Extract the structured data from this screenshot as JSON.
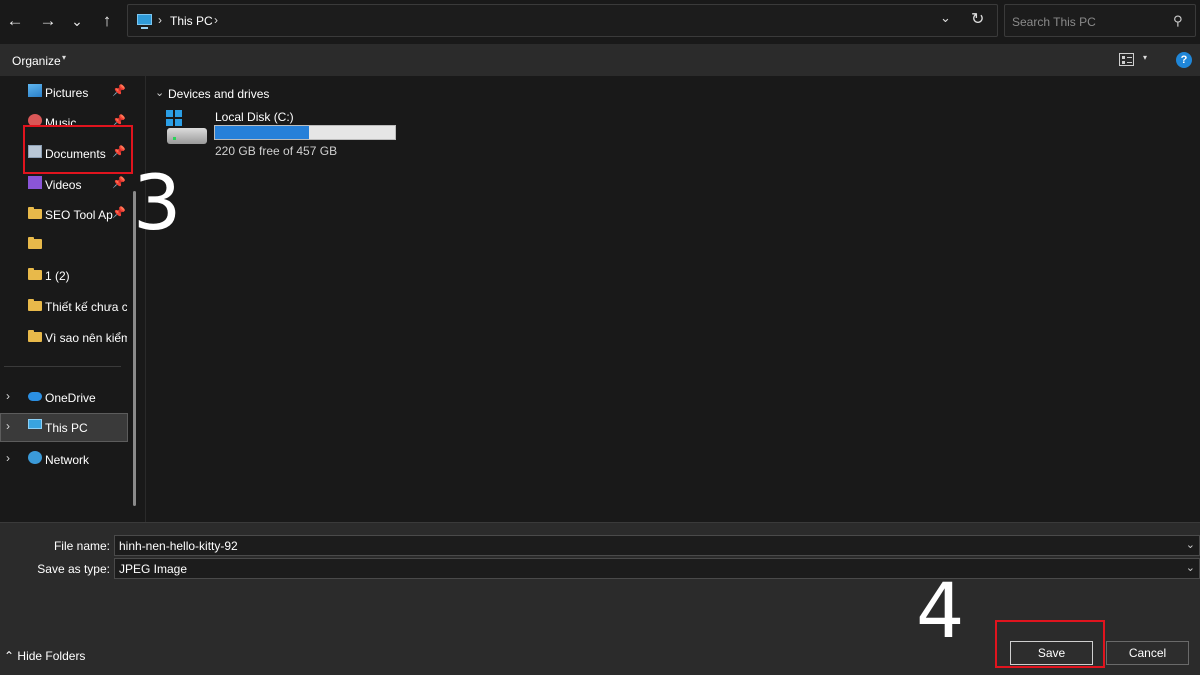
{
  "nav": {
    "back_icon": "←",
    "forward_icon": "→",
    "recent_icon": "⌄",
    "up_icon": "↑"
  },
  "address": {
    "separator": "›",
    "location": "This PC",
    "dropdown_icon": "⌄",
    "refresh_icon": "↻"
  },
  "search": {
    "placeholder": "Search This PC",
    "icon": "⚲"
  },
  "commandbar": {
    "organize_label": "Organize",
    "caret": "▾",
    "help_label": "?"
  },
  "sidebar": {
    "pin_glyph": "📌",
    "expander": "›",
    "items": [
      {
        "label": "Pictures",
        "icon": "pictures-icon",
        "pinned": true
      },
      {
        "label": "Music",
        "icon": "music-icon",
        "pinned": true
      },
      {
        "label": "Documents",
        "icon": "documents-icon",
        "pinned": true
      },
      {
        "label": "Videos",
        "icon": "videos-icon",
        "pinned": true
      },
      {
        "label": "SEO Tool App",
        "icon": "folder-icon",
        "pinned": true
      },
      {
        "label": "",
        "icon": "folder-icon",
        "pinned": false
      },
      {
        "label": "1 (2)",
        "icon": "folder-icon",
        "pinned": false
      },
      {
        "label": "Thiết kế chưa có",
        "icon": "folder-icon",
        "pinned": false
      },
      {
        "label": "Vì sao nên kiểm",
        "icon": "folder-icon",
        "pinned": false
      }
    ],
    "roots": [
      {
        "label": "OneDrive",
        "icon": "onedrive-icon",
        "selected": false
      },
      {
        "label": "This PC",
        "icon": "this-pc-icon",
        "selected": true
      },
      {
        "label": "Network",
        "icon": "network-icon",
        "selected": false
      }
    ]
  },
  "content": {
    "group_chevron": "⌄",
    "group_title": "Devices and drives",
    "drive": {
      "name": "Local Disk (C:)",
      "free_text": "220 GB free of 457 GB",
      "used_fraction": 0.52
    }
  },
  "save_panel": {
    "filename_label": "File name:",
    "filename_value": "hinh-nen-hello-kitty-92",
    "type_label": "Save as type:",
    "type_value": "JPEG Image",
    "dropdown_icon": "⌄",
    "hide_folders_label": "Hide Folders",
    "hide_folders_icon": "⌃",
    "save_label": "Save",
    "cancel_label": "Cancel"
  },
  "annotations": {
    "step_3": "3",
    "step_4": "4",
    "highlight_color": "#e0141e"
  }
}
